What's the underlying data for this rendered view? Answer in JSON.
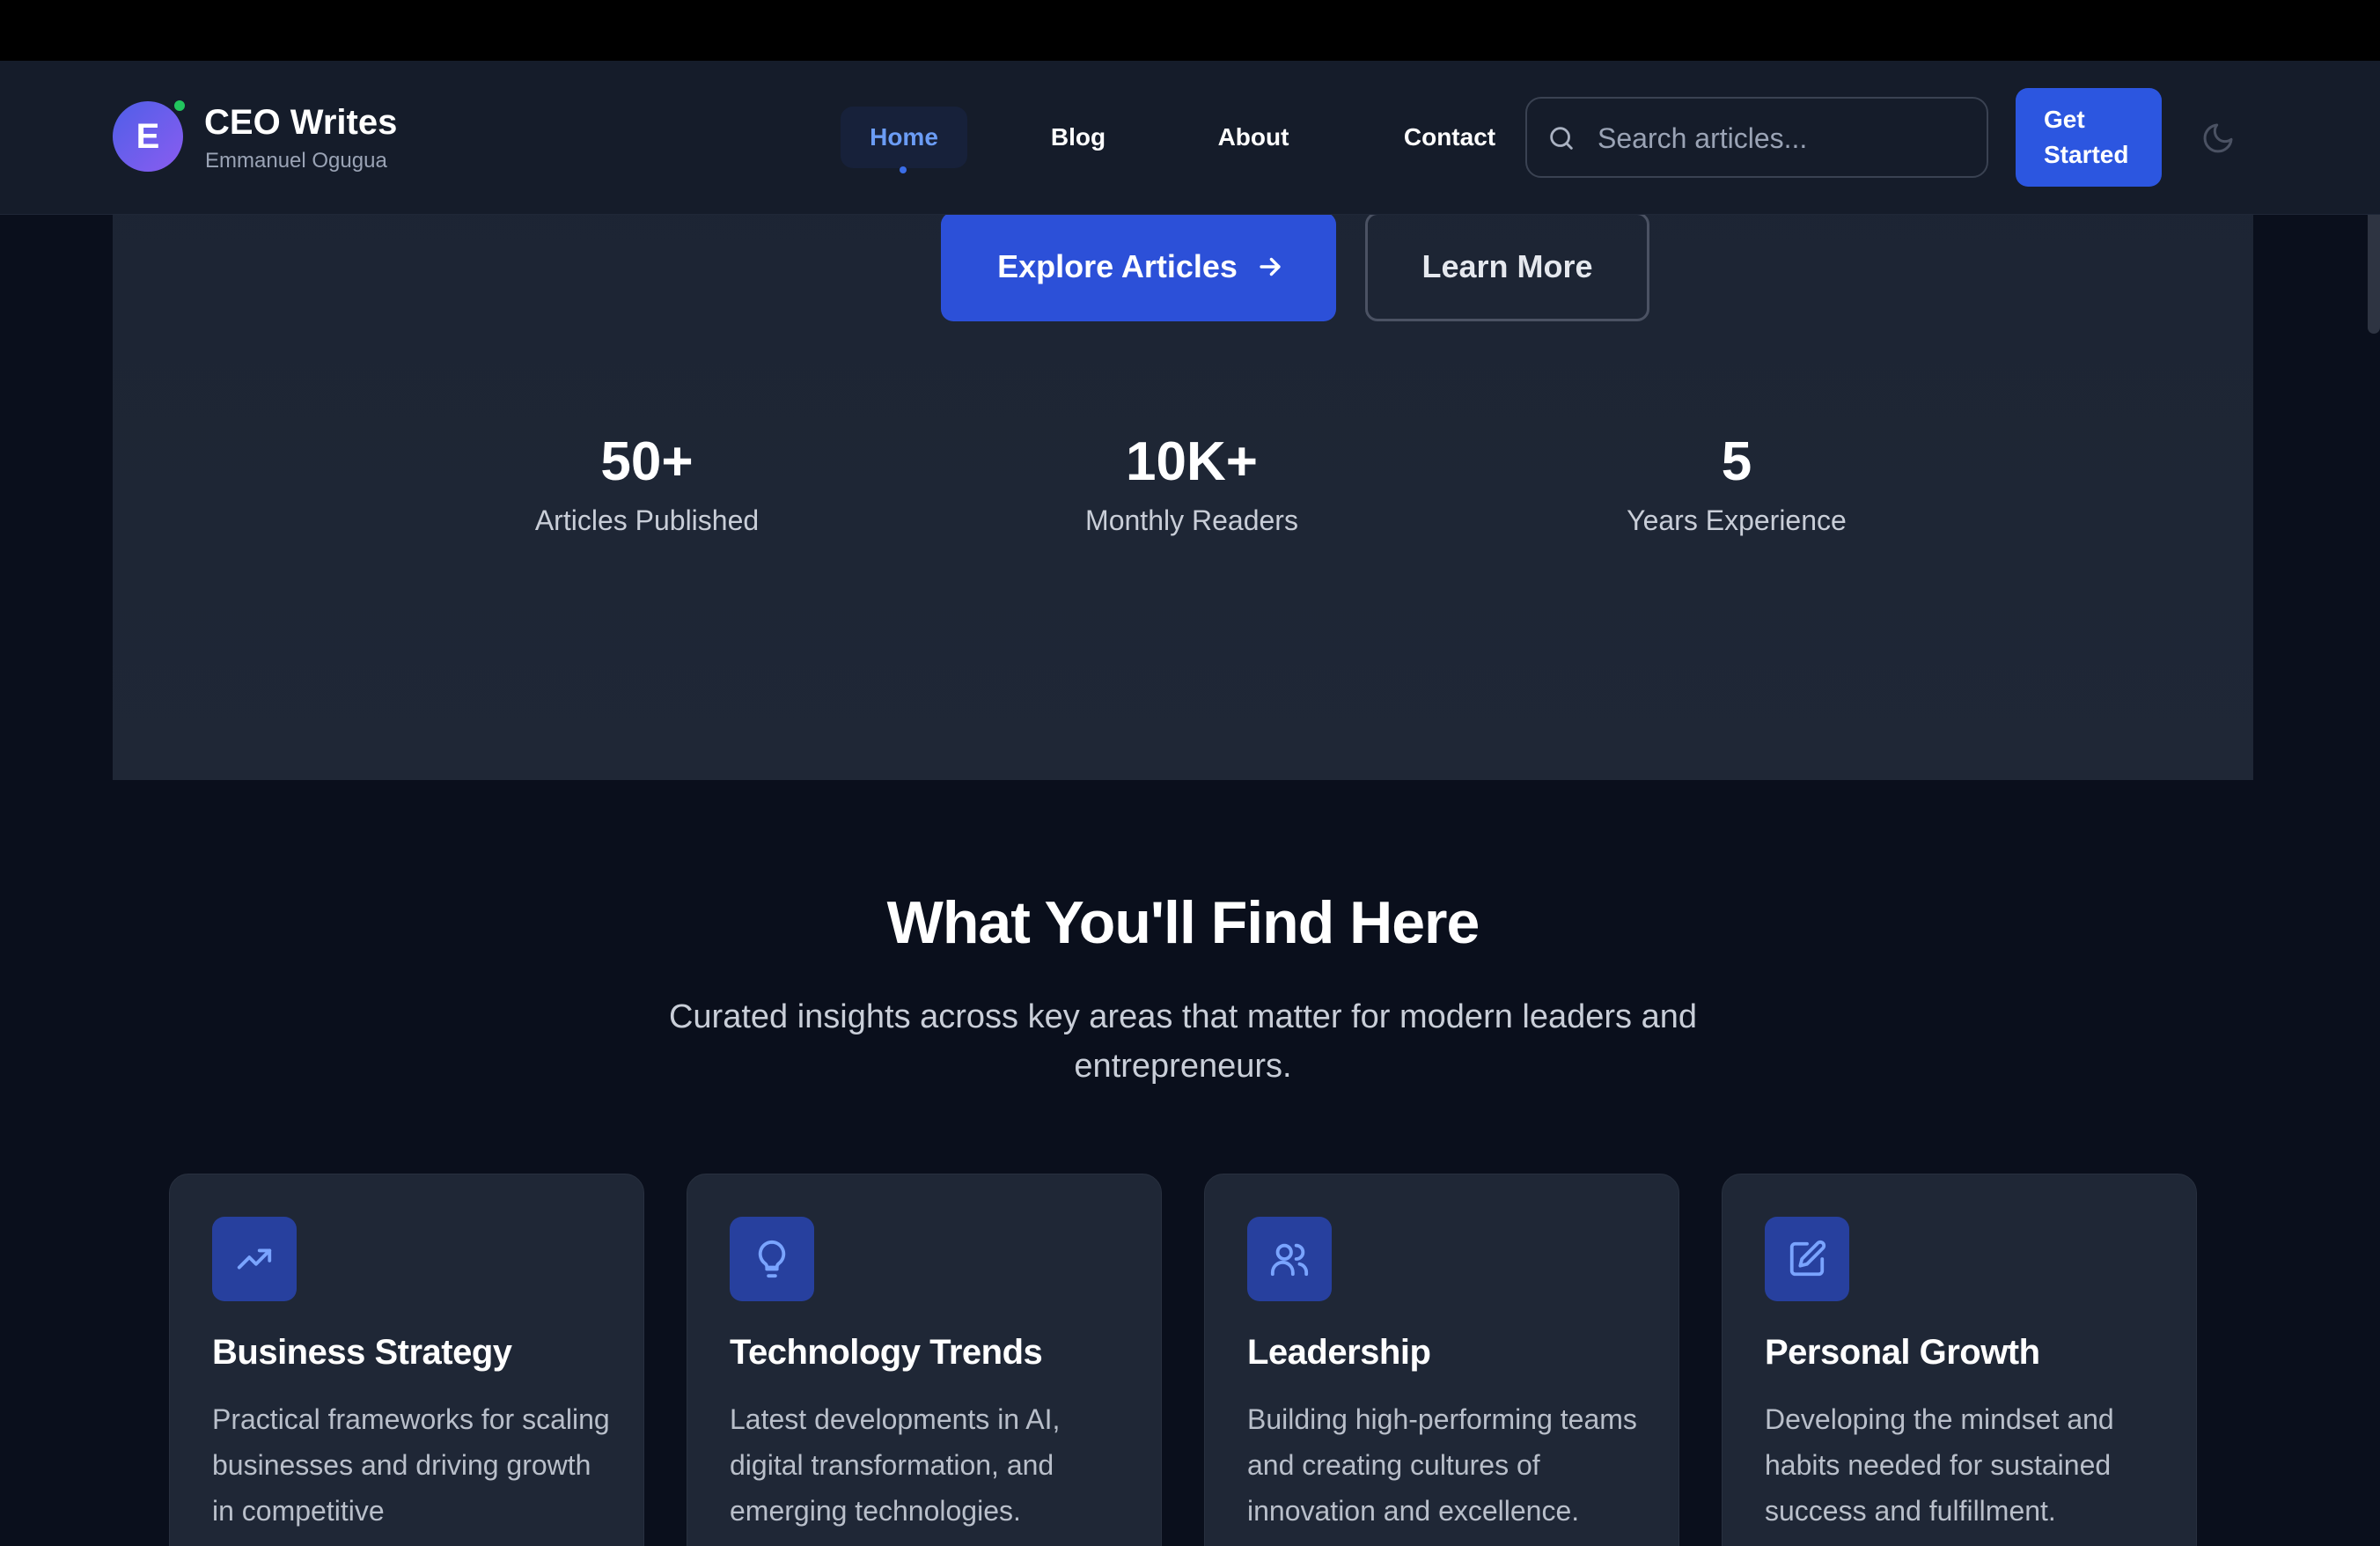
{
  "nav": {
    "logo_letter": "E",
    "brand_title": "CEO Writes",
    "brand_subtitle": "Emmanuel Ogugua",
    "links": [
      {
        "label": "Home",
        "active": true
      },
      {
        "label": "Blog",
        "active": false
      },
      {
        "label": "About",
        "active": false
      },
      {
        "label": "Contact",
        "active": false
      }
    ],
    "search_placeholder": "Search articles...",
    "search_icon": "search-icon",
    "cta_label_line1": "Get",
    "cta_label_line2": "Started",
    "theme_icon": "moon-icon"
  },
  "hero": {
    "primary_button": "Explore Articles",
    "primary_button_icon": "arrow-right-icon",
    "secondary_button": "Learn More",
    "stats": [
      {
        "value": "50+",
        "label": "Articles Published"
      },
      {
        "value": "10K+",
        "label": "Monthly Readers"
      },
      {
        "value": "5",
        "label": "Years Experience"
      }
    ]
  },
  "section": {
    "title": "What You'll Find Here",
    "subtitle_line1": "Curated insights across key areas that matter for modern leaders and",
    "subtitle_line2": "entrepreneurs.",
    "cards": [
      {
        "icon": "trending-up-icon",
        "title": "Business Strategy",
        "desc": "Practical frameworks for scaling businesses and driving growth in competitive"
      },
      {
        "icon": "lightbulb-icon",
        "title": "Technology Trends",
        "desc": "Latest developments in AI, digital transformation, and emerging technologies."
      },
      {
        "icon": "users-icon",
        "title": "Leadership",
        "desc": "Building high-performing teams and creating cultures of innovation and excellence."
      },
      {
        "icon": "edit-icon",
        "title": "Personal Growth",
        "desc": "Developing the mindset and habits needed for sustained success and fulfillment."
      }
    ]
  },
  "colors": {
    "accent": "#2c56e0",
    "page_bg": "#0a0f1c",
    "surface": "#1f2736",
    "icon_bg": "#27409e",
    "status_online": "#22c55e"
  }
}
